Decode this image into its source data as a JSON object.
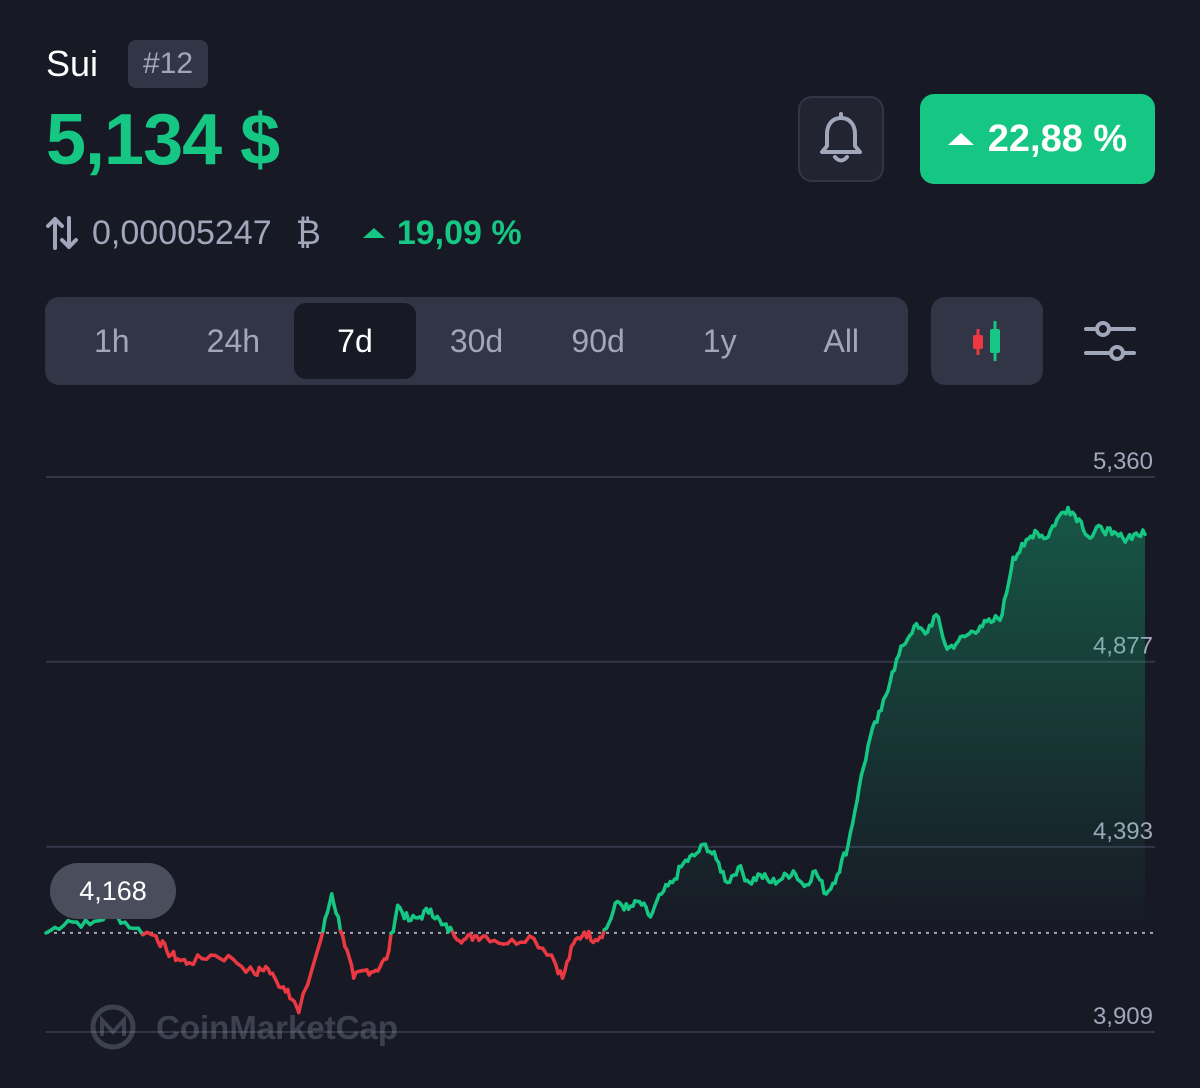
{
  "coin": {
    "name": "Sui",
    "rank": "#12",
    "price": "5,134 $",
    "change_pct": "22,88 %",
    "btc_value": "0,00005247",
    "btc_symbol": "₿",
    "btc_change_pct": "19,09 %"
  },
  "icons": {
    "bell": "bell-icon",
    "swap": "swap-arrows-icon",
    "candles": "candlestick-icon",
    "filter": "sliders-icon"
  },
  "colors": {
    "up": "#16c784",
    "down": "#ea3943",
    "background": "#171924",
    "panel": "#323546"
  },
  "ranges": {
    "items": [
      "1h",
      "24h",
      "7d",
      "30d",
      "90d",
      "1y",
      "All"
    ],
    "selected": "7d"
  },
  "chart_data": {
    "type": "line",
    "y_ticks": [
      "5,360",
      "4,877",
      "4,393",
      "3,909"
    ],
    "ylim": [
      3.909,
      5.36
    ],
    "baseline_label": "4,168",
    "baseline_value": 4.168,
    "watermark": "CoinMarketCap",
    "grid": true,
    "series": [
      {
        "x": [
          0,
          0.02,
          0.04,
          0.06,
          0.08,
          0.1,
          0.11,
          0.12,
          0.13,
          0.15,
          0.17,
          0.19,
          0.2,
          0.21,
          0.22,
          0.23,
          0.25,
          0.26,
          0.27,
          0.28,
          0.29,
          0.3,
          0.31,
          0.32,
          0.33,
          0.34,
          0.35,
          0.36,
          0.37,
          0.38,
          0.39,
          0.4,
          0.42,
          0.44,
          0.46,
          0.47,
          0.48,
          0.49,
          0.5,
          0.51,
          0.52,
          0.53,
          0.54,
          0.55,
          0.56,
          0.57,
          0.58,
          0.59,
          0.6,
          0.61,
          0.62,
          0.63,
          0.64,
          0.65,
          0.66,
          0.67,
          0.68,
          0.69,
          0.7,
          0.71,
          0.72,
          0.73,
          0.74,
          0.75,
          0.76,
          0.77,
          0.78,
          0.79,
          0.8,
          0.81,
          0.82,
          0.83,
          0.84,
          0.85,
          0.86,
          0.87,
          0.88,
          0.89,
          0.9,
          0.91,
          0.92,
          0.93,
          0.94,
          0.95,
          0.96,
          0.97,
          0.98,
          0.99,
          1
        ],
        "values": [
          4.168,
          4.2,
          4.19,
          4.22,
          4.18,
          4.16,
          4.12,
          4.1,
          4.09,
          4.11,
          4.1,
          4.06,
          4.08,
          4.04,
          4.02,
          3.96,
          4.15,
          4.27,
          4.16,
          4.05,
          4.07,
          4.07,
          4.1,
          4.24,
          4.2,
          4.21,
          4.23,
          4.19,
          4.17,
          4.15,
          4.16,
          4.16,
          4.14,
          4.16,
          4.11,
          4.05,
          4.14,
          4.17,
          4.15,
          4.18,
          4.25,
          4.23,
          4.25,
          4.21,
          4.27,
          4.3,
          4.35,
          4.37,
          4.4,
          4.36,
          4.3,
          4.34,
          4.3,
          4.32,
          4.3,
          4.31,
          4.33,
          4.29,
          4.33,
          4.27,
          4.32,
          4.4,
          4.55,
          4.68,
          4.75,
          4.85,
          4.92,
          4.97,
          4.95,
          5.0,
          4.91,
          4.93,
          4.95,
          4.97,
          4.98,
          5.0,
          5.15,
          5.18,
          5.22,
          5.2,
          5.25,
          5.28,
          5.25,
          5.2,
          5.23,
          5.21,
          5.2,
          5.21,
          5.21
        ]
      }
    ]
  }
}
